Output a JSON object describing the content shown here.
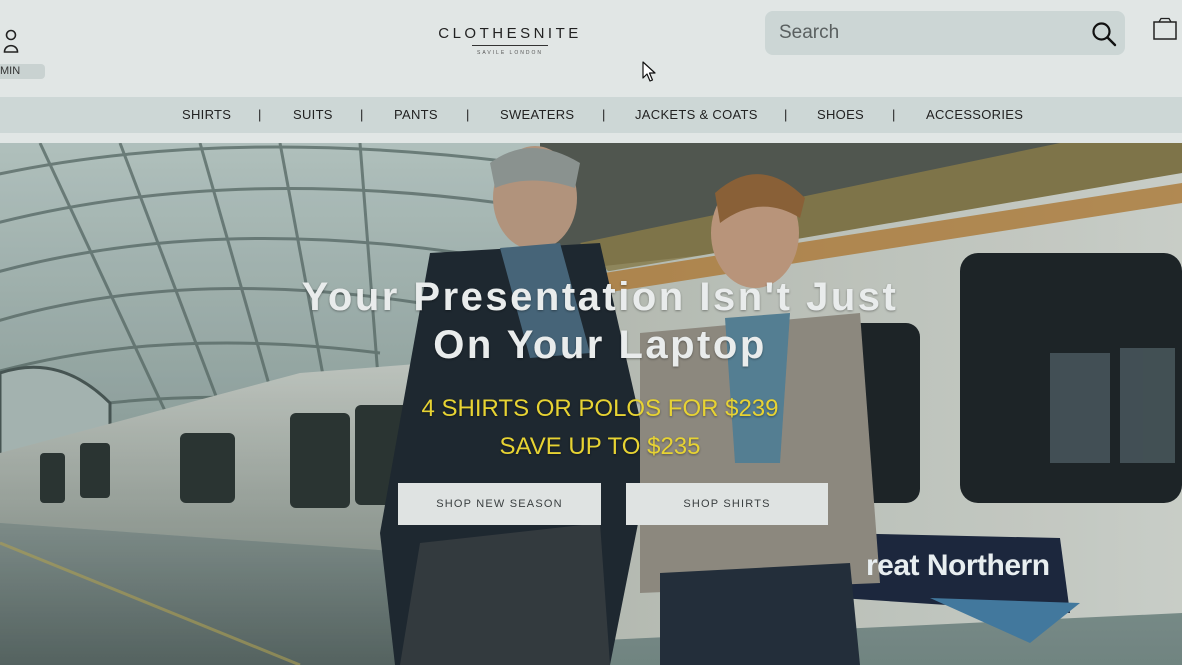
{
  "header": {
    "logo_text": "CLOTHESNITE",
    "logo_subtext": "SAVILE LONDON",
    "account_label": "MIN",
    "search": {
      "placeholder": "Search"
    }
  },
  "nav": {
    "items": [
      {
        "label": "SHIRTS"
      },
      {
        "label": "SUITS"
      },
      {
        "label": "PANTS"
      },
      {
        "label": "SWEATERS"
      },
      {
        "label": "JACKETS & COATS"
      },
      {
        "label": "SHOES"
      },
      {
        "label": "ACCESSORIES"
      }
    ],
    "separator": "|"
  },
  "hero": {
    "title_line1": "Your Presentation Isn't Just",
    "title_line2": "On Your Laptop",
    "offer_line1": "4 SHIRTS OR POLOS FOR $239",
    "offer_line2": "SAVE UP TO $235",
    "button_new_season": "SHOP NEW SEASON",
    "button_shirts": "SHOP SHIRTS",
    "train_signage": "reat Northern"
  },
  "colors": {
    "header_bg": "#e1e6e5",
    "nav_bg": "#cdd7d6",
    "search_bg": "#ccd6d5",
    "offer_yellow": "#e7d333",
    "button_bg": "#dfe3e2"
  },
  "icons": {
    "account": "user-icon",
    "search": "search-icon",
    "bag": "shopping-bag-icon",
    "cursor": "mouse-cursor-icon"
  }
}
